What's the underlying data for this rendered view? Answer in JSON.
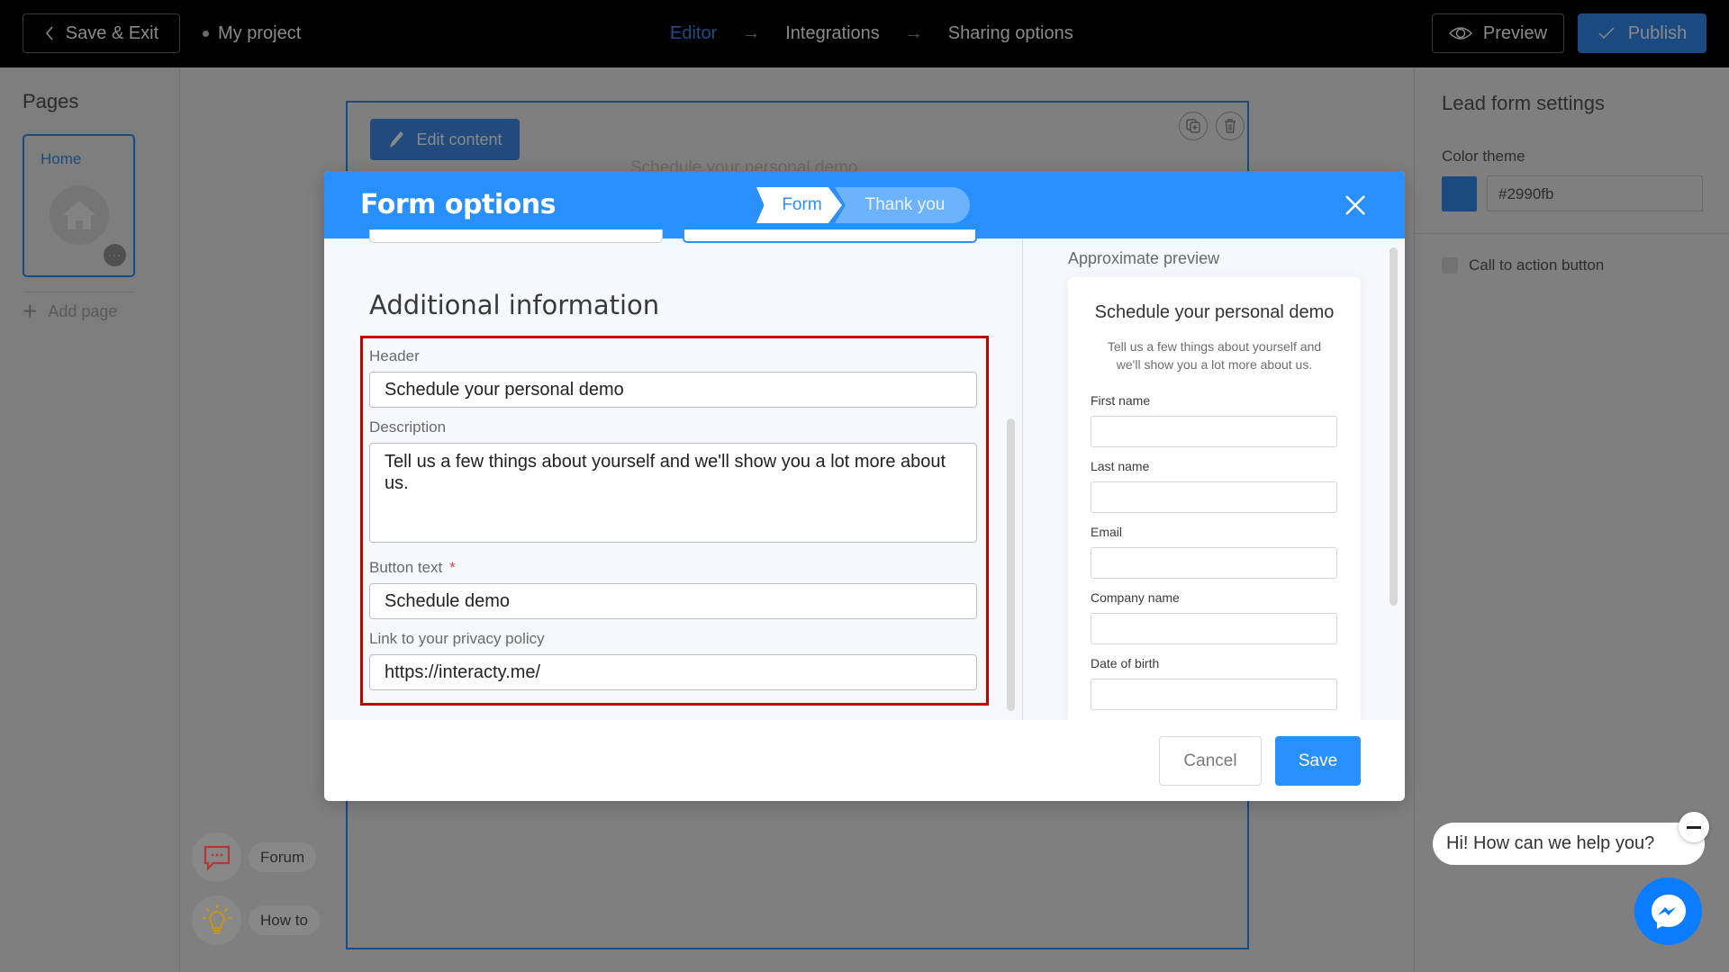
{
  "topbar": {
    "save_exit_label": "Save & Exit",
    "project_name": "My project",
    "steps": [
      {
        "label": "Editor",
        "active": true
      },
      {
        "label": "Integrations",
        "active": false
      },
      {
        "label": "Sharing options",
        "active": false
      }
    ],
    "step_arrow": "→",
    "preview_label": "Preview",
    "publish_label": "Publish"
  },
  "sidebar": {
    "title": "Pages",
    "pages": [
      {
        "label": "Home"
      }
    ],
    "more_label": "···",
    "add_page_label": "Add page"
  },
  "canvas": {
    "edit_content_label": "Edit content",
    "block_heading": "Schedule your personal demo"
  },
  "help": {
    "forum_label": "Forum",
    "howto_label": "How to"
  },
  "right_panel": {
    "title": "Lead form settings",
    "color_theme_label": "Color theme",
    "color_value": "#2990fb",
    "cta_label": "Call to action button",
    "cta_checked": false
  },
  "chat": {
    "greeting": "Hi! How can we help you?"
  },
  "modal": {
    "title": "Form options",
    "tabs": [
      {
        "label": "Form",
        "active": true
      },
      {
        "label": "Thank you",
        "active": false
      }
    ],
    "section_title": "Additional information",
    "fields": {
      "header_label": "Header",
      "header_value": "Schedule your personal demo",
      "description_label": "Description",
      "description_value": "Tell us a few things about yourself and we'll show you a lot more about us.",
      "button_text_label": "Button text",
      "button_text_required": "*",
      "button_text_value": "Schedule demo",
      "privacy_label": "Link to your privacy policy",
      "privacy_value": "https://interacty.me/"
    },
    "preview": {
      "label": "Approximate preview",
      "title": "Schedule your personal demo",
      "description": "Tell us a few things about yourself and we'll show you a lot more about us.",
      "fields": [
        "First name",
        "Last name",
        "Email",
        "Company name",
        "Date of birth"
      ]
    },
    "cancel_label": "Cancel",
    "save_label": "Save"
  },
  "colors": {
    "brand": "#2990fb",
    "highlight_box": "#c00000",
    "messenger": "#0a7cff"
  }
}
